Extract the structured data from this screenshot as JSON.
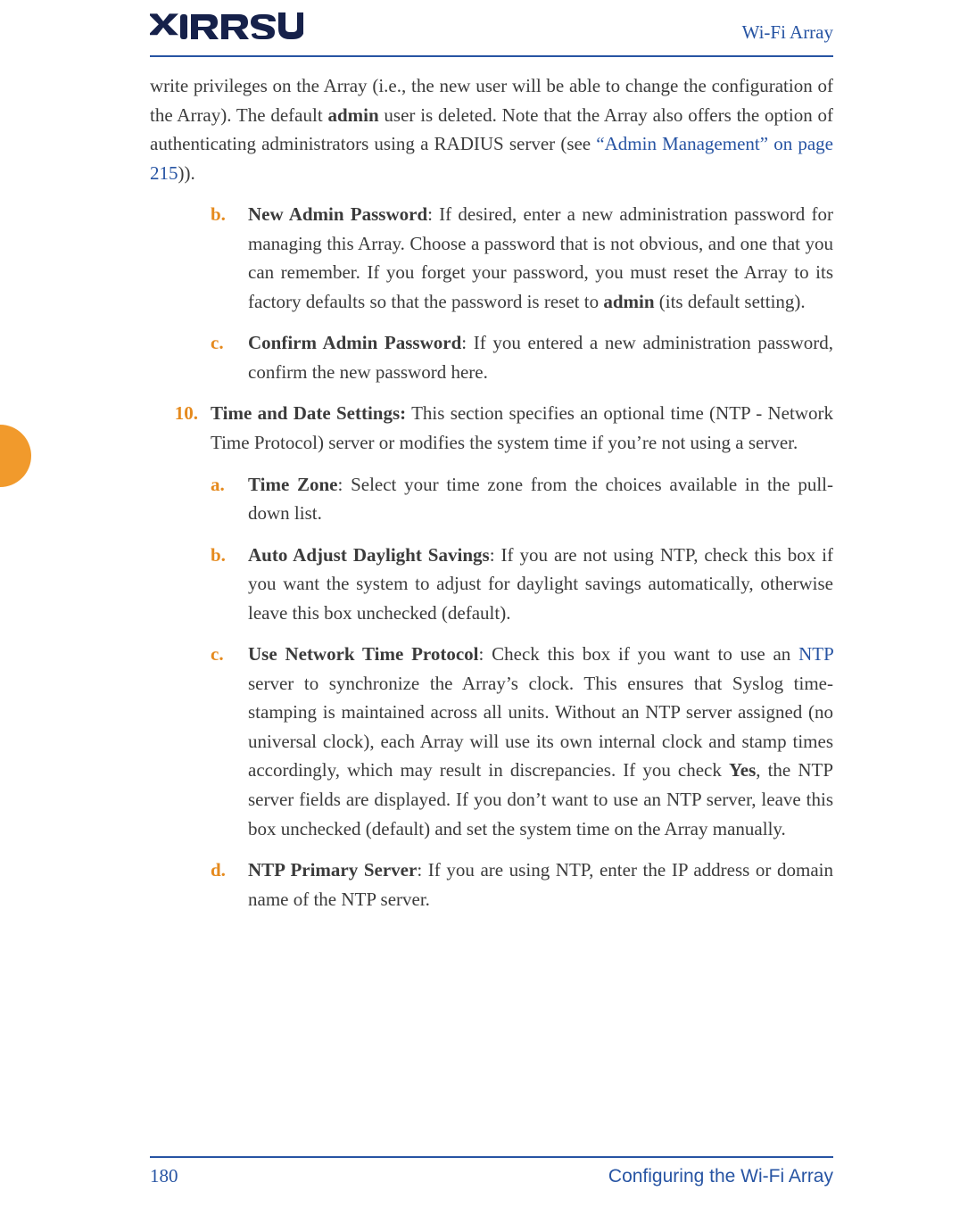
{
  "header": {
    "brand_text": "Wi-Fi Array"
  },
  "sideTab": {
    "present": true
  },
  "content": {
    "paraCont_pre": "write privileges on the Array (i.e., the new user will be able to change the configuration of the Array). The default ",
    "paraCont_bold1": "admin",
    "paraCont_mid": " user is deleted. Note that the Array also offers the option of authenticating administrators using a RADIUS server (see ",
    "paraCont_link": "“Admin Management” on page 215",
    "paraCont_post": ")).",
    "b_label": "b.",
    "b_bold": "New Admin Password",
    "b_mid1": ": If desired, enter a new administration password for managing this Array. Choose a password that is not obvious, and one that you can remember. If you forget your password, you must reset the Array to its factory defaults so that the password is reset to ",
    "b_bold2": "admin",
    "b_post": " (its default setting).",
    "c_label": "c.",
    "c_bold": "Confirm Admin Password",
    "c_post": ": If you entered a new administration password, confirm the new password here.",
    "n10_label": "10.",
    "n10_bold": "Time and Date Settings:",
    "n10_post": " This section specifies an optional time (NTP - Network Time Protocol) server or modifies the system time if you’re not using a server.",
    "a2_label": "a.",
    "a2_bold": "Time Zone",
    "a2_post": ": Select your time zone from the choices available in the pull-down list.",
    "b2_label": "b.",
    "b2_bold": "Auto Adjust Daylight Savings",
    "b2_post": ": If you are not using NTP, check this box if you want the system to adjust for daylight savings automatically, otherwise leave this box unchecked (default).",
    "c2_label": "c.",
    "c2_bold": "Use Network Time Protocol",
    "c2_mid1": ": Check this box if you want to use an ",
    "c2_link": "NTP",
    "c2_mid2": " server to synchronize the Array’s clock. This ensures that Syslog time-stamping is maintained across all units. Without an NTP server assigned (no universal clock), each Array will use its own internal clock and stamp times accordingly, which may result in discrepancies. If you check ",
    "c2_bold2": "Yes",
    "c2_post": ", the NTP server fields are displayed. If you don’t want to use an NTP server, leave this box unchecked (default) and set the system time on the Array manually.",
    "d2_label": "d.",
    "d2_bold": "NTP Primary Server",
    "d2_post": ": If you are using NTP, enter the IP address or domain name of the NTP server."
  },
  "footer": {
    "page_number": "180",
    "title": "Configuring the Wi-Fi Array"
  }
}
